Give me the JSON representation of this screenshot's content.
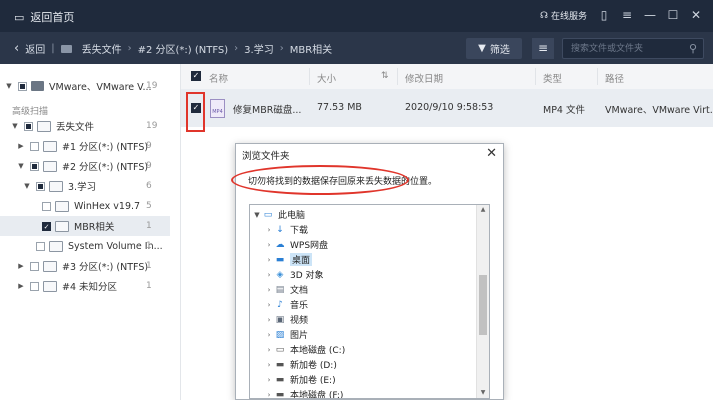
{
  "titlebar": {
    "back_home_label": "返回首页",
    "online_service_label": "在线服务",
    "icons": [
      "chat-icon",
      "menu-icon",
      "minimize-icon",
      "maximize-icon",
      "close-icon"
    ]
  },
  "navbar": {
    "back_label": "返回",
    "breadcrumbs": [
      "丢失文件",
      "#2 分区(*:) (NTFS)",
      "3.学习",
      "MBR相关"
    ],
    "filter_label": "筛选",
    "search_placeholder": "搜索文件或文件夹"
  },
  "sidebar": {
    "section_label": "高级扫描",
    "items": [
      {
        "label": "VMware、VMware V...",
        "count": "19"
      },
      {
        "label": "丢失文件",
        "count": "19"
      },
      {
        "label": "#1 分区(*:) (NTFS)",
        "count": "9"
      },
      {
        "label": "#2 分区(*:) (NTFS)",
        "count": "9"
      },
      {
        "label": "3.学习",
        "count": "6"
      },
      {
        "label": "WinHex v19.7",
        "count": "5"
      },
      {
        "label": "MBR相关",
        "count": "1"
      },
      {
        "label": "System Volume In...",
        "count": "1"
      },
      {
        "label": "#3 分区(*:) (NTFS)",
        "count": "1"
      },
      {
        "label": "#4 未知分区",
        "count": "1"
      }
    ]
  },
  "table": {
    "headers": [
      "名称",
      "大小",
      "修改日期",
      "类型",
      "路径"
    ],
    "rows": [
      {
        "name": "修复MBR磁盘...",
        "size": "77.53 MB",
        "date": "2020/9/10 9:58:53",
        "type": "MP4 文件",
        "path": "VMware、VMware Virt..."
      }
    ],
    "file_icon_label": "MP4"
  },
  "dialog": {
    "title": "浏览文件夹",
    "message": "切勿将找到的数据保存回原来丢失数据的位置。",
    "tree": [
      {
        "label": "此电脑",
        "icon": "computer-icon",
        "expanded": true
      },
      {
        "label": "下载",
        "icon": "download-icon"
      },
      {
        "label": "WPS网盘",
        "icon": "cloud-icon"
      },
      {
        "label": "桌面",
        "icon": "desktop-icon",
        "selected": true
      },
      {
        "label": "3D 对象",
        "icon": "cube-icon"
      },
      {
        "label": "文档",
        "icon": "document-icon"
      },
      {
        "label": "音乐",
        "icon": "music-icon"
      },
      {
        "label": "视频",
        "icon": "video-icon"
      },
      {
        "label": "图片",
        "icon": "picture-icon"
      },
      {
        "label": "本地磁盘 (C:)",
        "icon": "drive-icon"
      },
      {
        "label": "新加卷 (D:)",
        "icon": "drive-icon"
      },
      {
        "label": "新加卷 (E:)",
        "icon": "drive-icon"
      },
      {
        "label": "本地磁盘 (F:)",
        "icon": "drive-icon"
      }
    ]
  },
  "colors": {
    "titlebar_bg": "#1f2a3c",
    "navbar_bg": "#2b3649",
    "annotation_red": "#e0352b",
    "selected_row": "#e9edf2"
  }
}
